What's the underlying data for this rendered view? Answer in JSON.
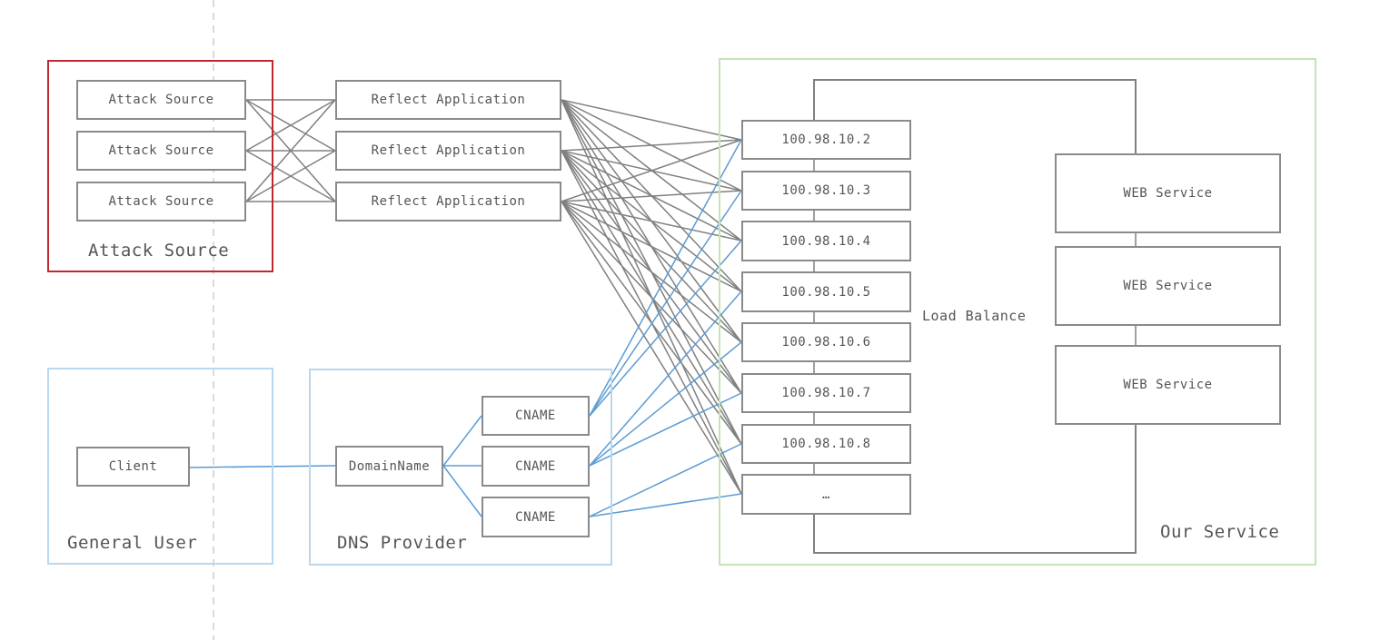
{
  "colors": {
    "attack_group_border": "#c0282f",
    "user_group_border": "#b9d7ee",
    "service_group_border": "#c5e3b5",
    "node_border": "#8a8a8a",
    "attack_link": "#808080",
    "user_link": "#5b9bd5",
    "divider": "#b5b5b5"
  },
  "groups": {
    "attack": {
      "label": "Attack Source"
    },
    "general_user": {
      "label": "General User"
    },
    "dns": {
      "label": "DNS Provider"
    },
    "our_service": {
      "label": "Our Service"
    }
  },
  "attack_sources": [
    "Attack Source",
    "Attack Source",
    "Attack Source"
  ],
  "reflectors": [
    "Reflect Application",
    "Reflect Application",
    "Reflect Application"
  ],
  "client": "Client",
  "domain_name": "DomainName",
  "cnames": [
    "CNAME",
    "CNAME",
    "CNAME"
  ],
  "load_balance_label": "Load Balance",
  "ips": [
    "100.98.10.2",
    "100.98.10.3",
    "100.98.10.4",
    "100.98.10.5",
    "100.98.10.6",
    "100.98.10.7",
    "100.98.10.8",
    "…"
  ],
  "web_services": [
    "WEB Service",
    "WEB Service",
    "WEB Service"
  ],
  "links": {
    "attack_to_reflector": "all-to-all",
    "reflector_to_ip": "all-to-all",
    "cname_to_ip": [
      [
        0,
        1,
        2
      ],
      [
        3,
        4,
        5
      ],
      [
        6,
        7
      ]
    ]
  }
}
